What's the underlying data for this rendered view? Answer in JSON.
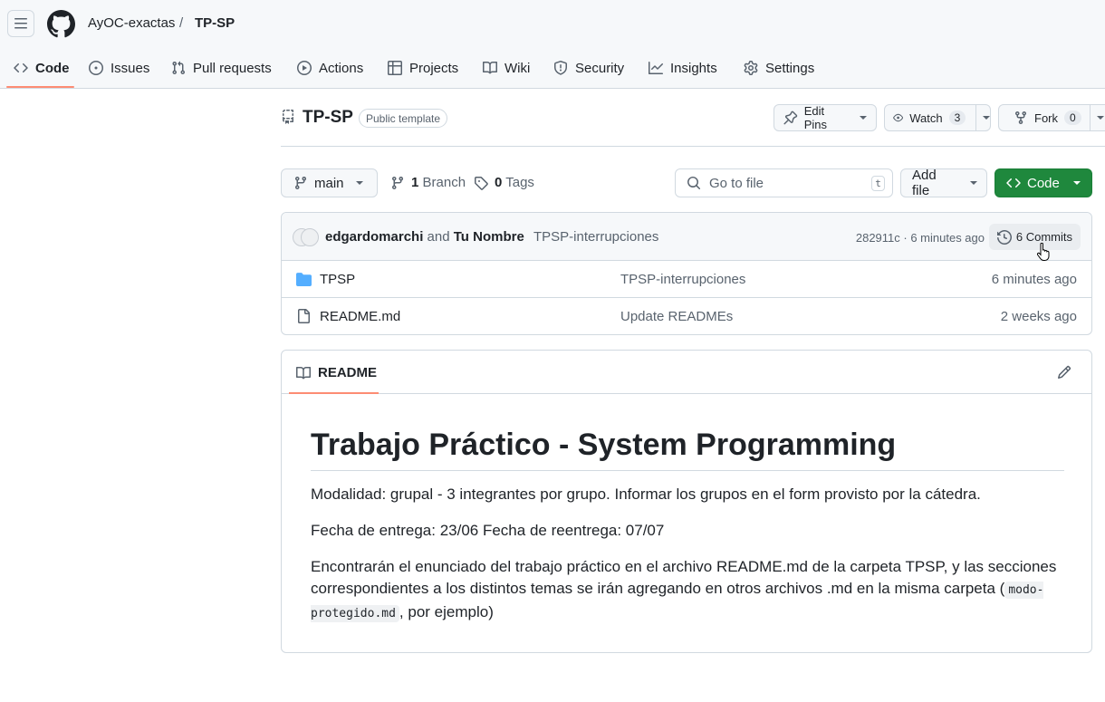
{
  "header": {
    "owner": "AyOC-exactas",
    "separator": "/",
    "repo": "TP-SP"
  },
  "tabs": [
    {
      "label": "Code",
      "icon": "code-icon",
      "active": true
    },
    {
      "label": "Issues",
      "icon": "issue-icon"
    },
    {
      "label": "Pull requests",
      "icon": "pull-request-icon"
    },
    {
      "label": "Actions",
      "icon": "play-icon"
    },
    {
      "label": "Projects",
      "icon": "table-icon"
    },
    {
      "label": "Wiki",
      "icon": "book-icon"
    },
    {
      "label": "Security",
      "icon": "shield-icon"
    },
    {
      "label": "Insights",
      "icon": "graph-icon"
    },
    {
      "label": "Settings",
      "icon": "gear-icon"
    }
  ],
  "repo_header": {
    "name": "TP-SP",
    "visibility": "Public template",
    "edit_pins": "Edit Pins",
    "watch": "Watch",
    "watch_count": "3",
    "fork": "Fork",
    "fork_count": "0"
  },
  "toolbar": {
    "branch": "main",
    "branch_count": "1",
    "branch_label": "Branch",
    "tag_count": "0",
    "tag_label": "Tags",
    "search_placeholder": "Go to file",
    "search_kbd": "t",
    "add_file": "Add file",
    "code": "Code"
  },
  "latest_commit": {
    "author1": "edgardomarchi",
    "and": "and",
    "author2": "Tu Nombre",
    "message": "TPSP-interrupciones",
    "meta": "282911c · 6 minutes ago",
    "commits": "6 Commits"
  },
  "files": [
    {
      "name": "TPSP",
      "type": "folder",
      "message": "TPSP-interrupciones",
      "date": "6 minutes ago"
    },
    {
      "name": "README.md",
      "type": "file",
      "message": "Update READMEs",
      "date": "2 weeks ago"
    }
  ],
  "readme": {
    "tab": "README",
    "title": "Trabajo Práctico - System Programming",
    "p1": "Modalidad: grupal - 3 integrantes por grupo. Informar los grupos en el form provisto por la cátedra.",
    "p2": "Fecha de entrega: 23/06 Fecha de reentrega: 07/07",
    "p3_a": "Encontrarán el enunciado del trabajo práctico en el archivo README.md de la carpeta TPSP, y las secciones correspondientes a los distintos temas se irán agregando en otros archivos .md en la misma carpeta (",
    "p3_code": "modo-protegido.md",
    "p3_b": ", por ejemplo)"
  },
  "colors": {
    "accent_underline": "#fd8c73",
    "code_button": "#1f883d",
    "folder": "#54aeff"
  }
}
